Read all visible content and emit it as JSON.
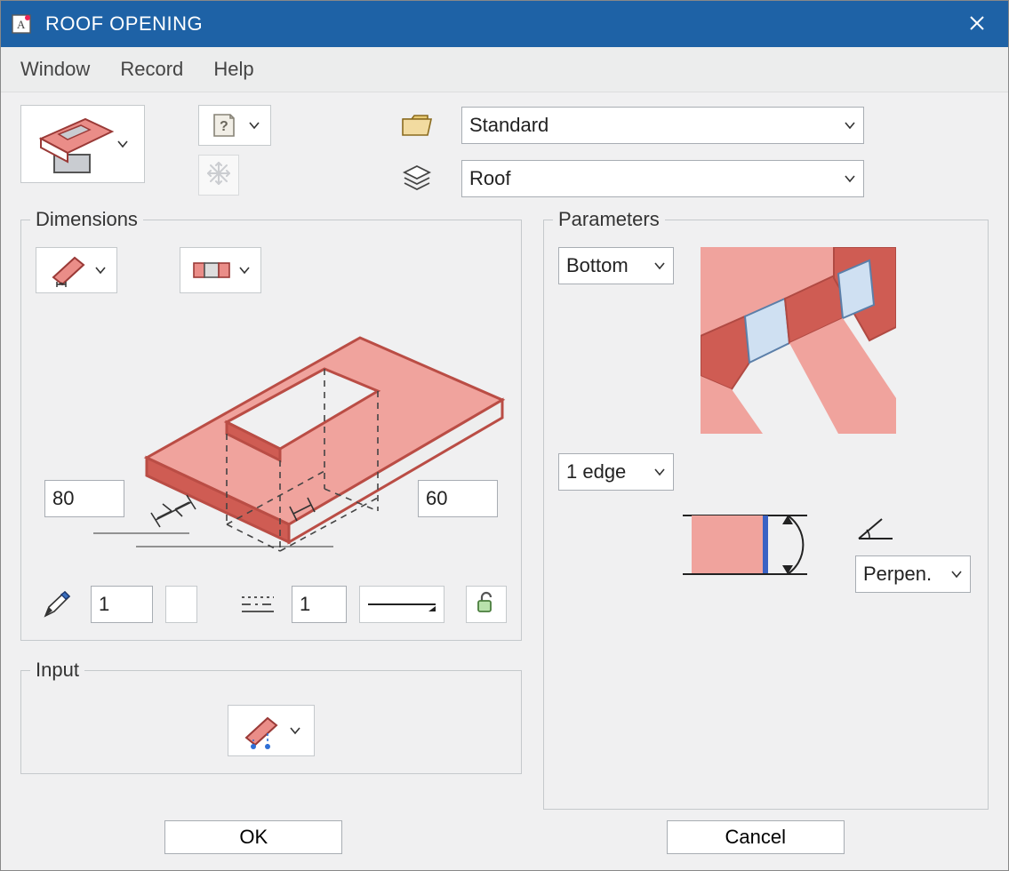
{
  "window": {
    "title": "ROOF OPENING"
  },
  "menu": {
    "window": "Window",
    "record": "Record",
    "help": "Help"
  },
  "toolbar": {
    "style_dropdown": "Standard",
    "layer_dropdown": "Roof"
  },
  "groups": {
    "dimensions": "Dimensions",
    "parameters": "Parameters",
    "input": "Input"
  },
  "dimensions": {
    "value_a": "80",
    "value_b": "60",
    "pen_value": "1",
    "line_value": "1"
  },
  "parameters": {
    "ref_dropdown": "Bottom",
    "edge_dropdown": "1 edge",
    "angle_dropdown": "Perpen."
  },
  "buttons": {
    "ok": "OK",
    "cancel": "Cancel"
  }
}
